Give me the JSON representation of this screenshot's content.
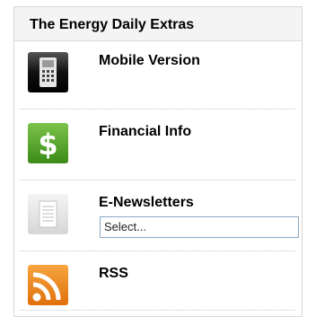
{
  "widget": {
    "title": "The Energy Daily Extras"
  },
  "items": [
    {
      "label": "Mobile Version",
      "icon": "mobile-phone-icon"
    },
    {
      "label": "Financial Info",
      "icon": "dollar-icon"
    },
    {
      "label": "E-Newsletters",
      "icon": "newsletter-icon",
      "select": {
        "selected": "Select..."
      }
    },
    {
      "label": "RSS",
      "icon": "rss-icon"
    }
  ],
  "colors": {
    "mobile_icon_bg": "#1a1a1a",
    "financial_icon_bg": "#4a9a22",
    "newsletter_icon_bg": "#e4e4e4",
    "rss_icon_bg": "#f08a1a",
    "select_border": "#8aa8c4"
  }
}
